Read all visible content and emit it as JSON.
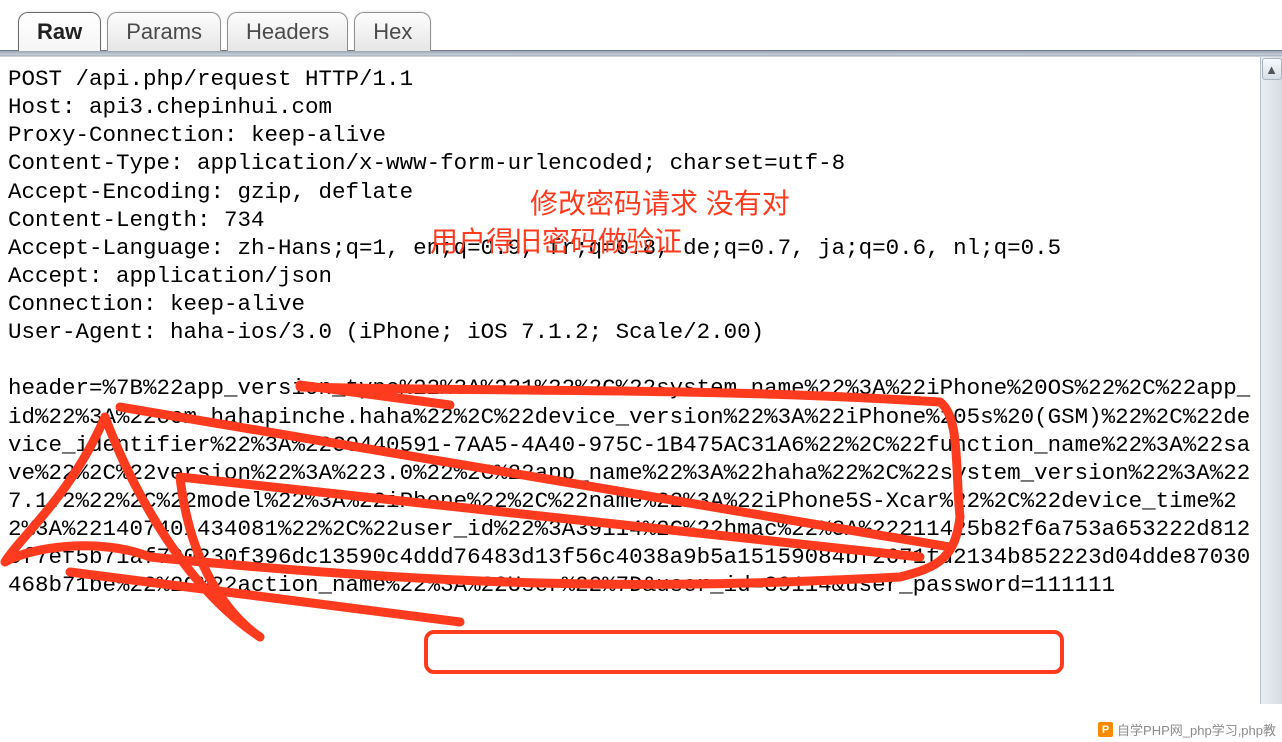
{
  "tabs": {
    "raw": "Raw",
    "params": "Params",
    "headers": "Headers",
    "hex": "Hex",
    "active": "raw"
  },
  "request": {
    "line": "POST /api.php/request HTTP/1.1",
    "headers": {
      "host": "Host: api3.chepinhui.com",
      "proxy_connection": "Proxy-Connection: keep-alive",
      "content_type": "Content-Type: application/x-www-form-urlencoded; charset=utf-8",
      "accept_encoding": "Accept-Encoding: gzip, deflate",
      "content_length": "Content-Length: 734",
      "accept_language": "Accept-Language: zh-Hans;q=1, en;q=0.9, fr;q=0.8, de;q=0.7, ja;q=0.6, nl;q=0.5",
      "accept": "Accept: application/json",
      "connection": "Connection: keep-alive",
      "user_agent": "User-Agent: haha-ios/3.0 (iPhone; iOS 7.1.2; Scale/2.00)"
    },
    "body": "header=%7B%22app_version_type%22%3A%221%22%2C%22system_name%22%3A%22iPhone%20OS%22%2C%22app_id%22%3A%22com.hahapinche.haha%22%2C%22device_version%22%3A%22iPhone%205s%20(GSM)%22%2C%22device_identifier%22%3A%22C0440591-7AA5-4A40-975C-1B475AC31A6%22%2C%22function_name%22%3A%22save%22%2C%22version%22%3A%223.0%22%2C%22app_name%22%3A%22haha%22%2C%22system_version%22%3A%227.1.2%22%2C%22model%22%3A%22iPhone%22%2C%22name%22%3A%22iPhone5S-Xcar%22%2C%22device_time%22%3A%221407401434081%22%2C%22user_id%22%3A39114%2C%22hmac%22%3A%22211425b82f6a753a653222d812cf7ef5b71af790230f396dc13590c4ddd76483d13f56c4038a9b5a15159084bf2671fd2134b852223d04dde87030468b71be%22%2C%22action_name%22%3A%22User%22%7D&user_id=39114&user_password=111111",
    "highlighted_params": "user_id=39114&user_password=111111"
  },
  "annotations": {
    "line1": "修改密码请求 没有对",
    "line2": "用户得旧密码做验证",
    "color": "#ff3b1f"
  },
  "footer": {
    "icon_letter": "P",
    "text": "自学PHP网_php学习,php教"
  }
}
